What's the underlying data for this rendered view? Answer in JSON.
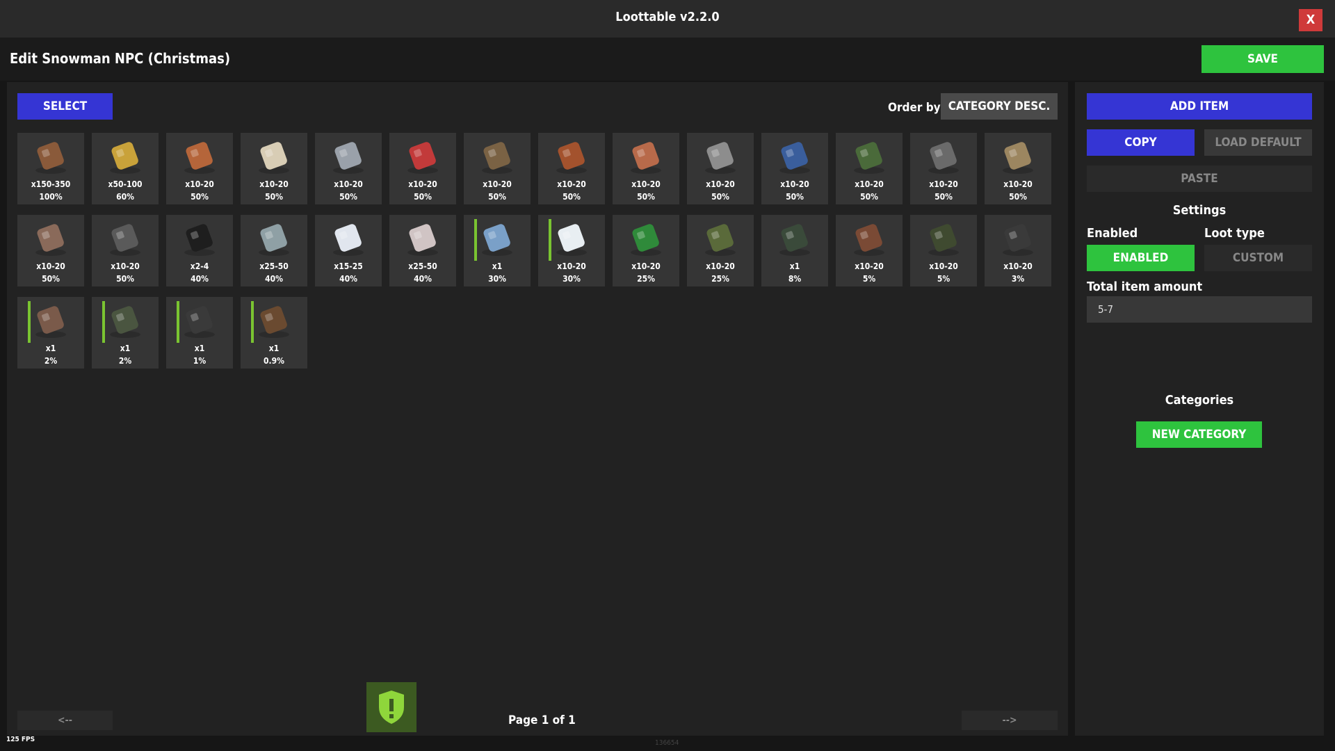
{
  "window": {
    "title": "Loottable v2.2.0",
    "close_label": "X"
  },
  "header": {
    "page_title": "Edit Snowman NPC (Christmas)",
    "save_label": "SAVE"
  },
  "toolbar": {
    "select_label": "SELECT",
    "order_by_label": "Order by",
    "order_by_value": "CATEGORY DESC."
  },
  "items": [
    {
      "icon": "gears-icon",
      "qty": "x150-350",
      "pct": "100%"
    },
    {
      "icon": "ammo-icon",
      "qty": "x50-100",
      "pct": "60%"
    },
    {
      "icon": "pipe-icon",
      "qty": "x10-20",
      "pct": "50%"
    },
    {
      "icon": "propane-tank-icon",
      "qty": "x10-20",
      "pct": "50%"
    },
    {
      "icon": "metal-blade-icon",
      "qty": "x10-20",
      "pct": "50%"
    },
    {
      "icon": "road-sign-icon",
      "qty": "x10-20",
      "pct": "50%"
    },
    {
      "icon": "rope-icon",
      "qty": "x10-20",
      "pct": "50%"
    },
    {
      "icon": "sewing-kit-icon",
      "qty": "x10-20",
      "pct": "50%"
    },
    {
      "icon": "sheet-metal-icon",
      "qty": "x10-20",
      "pct": "50%"
    },
    {
      "icon": "spring-icon",
      "qty": "x10-20",
      "pct": "50%"
    },
    {
      "icon": "tarp-icon",
      "qty": "x10-20",
      "pct": "50%"
    },
    {
      "icon": "tech-trash-icon",
      "qty": "x10-20",
      "pct": "50%"
    },
    {
      "icon": "rifle-body-icon",
      "qty": "x10-20",
      "pct": "50%"
    },
    {
      "icon": "smg-body-icon",
      "qty": "x10-20",
      "pct": "50%"
    },
    {
      "icon": "semi-body-icon",
      "qty": "x10-20",
      "pct": "50%"
    },
    {
      "icon": "gear-icon",
      "qty": "x10-20",
      "pct": "50%"
    },
    {
      "icon": "fuel-barrel-icon",
      "qty": "x2-4",
      "pct": "40%"
    },
    {
      "icon": "metal-ore-icon",
      "qty": "x25-50",
      "pct": "40%"
    },
    {
      "icon": "bleach-icon",
      "qty": "x15-25",
      "pct": "40%"
    },
    {
      "icon": "duct-tape-icon",
      "qty": "x25-50",
      "pct": "40%"
    },
    {
      "icon": "snowball-gun-icon",
      "qty": "x1",
      "pct": "30%",
      "bar": true
    },
    {
      "icon": "snowball-icon",
      "qty": "x10-20",
      "pct": "30%",
      "bar": true
    },
    {
      "icon": "green-crate-icon",
      "qty": "x10-20",
      "pct": "25%"
    },
    {
      "icon": "rocket-icon",
      "qty": "x10-20",
      "pct": "25%"
    },
    {
      "icon": "grenade-icon",
      "qty": "x1",
      "pct": "8%"
    },
    {
      "icon": "rocket-hv-icon",
      "qty": "x10-20",
      "pct": "5%"
    },
    {
      "icon": "rocket-incendiary-icon",
      "qty": "x10-20",
      "pct": "5%"
    },
    {
      "icon": "metal-pipe-bundle-icon",
      "qty": "x10-20",
      "pct": "3%"
    },
    {
      "icon": "assault-rifle-icon",
      "qty": "x1",
      "pct": "2%",
      "bar": true
    },
    {
      "icon": "bolt-rifle-icon",
      "qty": "x1",
      "pct": "2%",
      "bar": true
    },
    {
      "icon": "lmg-icon",
      "qty": "x1",
      "pct": "1%",
      "bar": true
    },
    {
      "icon": "rocket-launcher-icon",
      "qty": "x1",
      "pct": "0.9%",
      "bar": true
    }
  ],
  "pagination": {
    "prev_label": "<--",
    "next_label": "-->",
    "page_label": "Page 1 of 1"
  },
  "sidebar": {
    "add_item_label": "ADD ITEM",
    "copy_label": "COPY",
    "load_default_label": "LOAD DEFAULT",
    "paste_label": "PASTE",
    "settings_heading": "Settings",
    "enabled_label": "Enabled",
    "enabled_value": "ENABLED",
    "loot_type_label": "Loot type",
    "loot_type_value": "CUSTOM",
    "total_amount_label": "Total item amount",
    "total_amount_value": "5-7",
    "categories_heading": "Categories",
    "new_category_label": "NEW CATEGORY"
  },
  "status": {
    "fps": "125 FPS",
    "id": "136654"
  },
  "colors": {
    "green": "#2ec33e",
    "blue": "#3535d4",
    "red": "#cf3a3a",
    "slot": "#353535",
    "bar": "#7ac431"
  }
}
